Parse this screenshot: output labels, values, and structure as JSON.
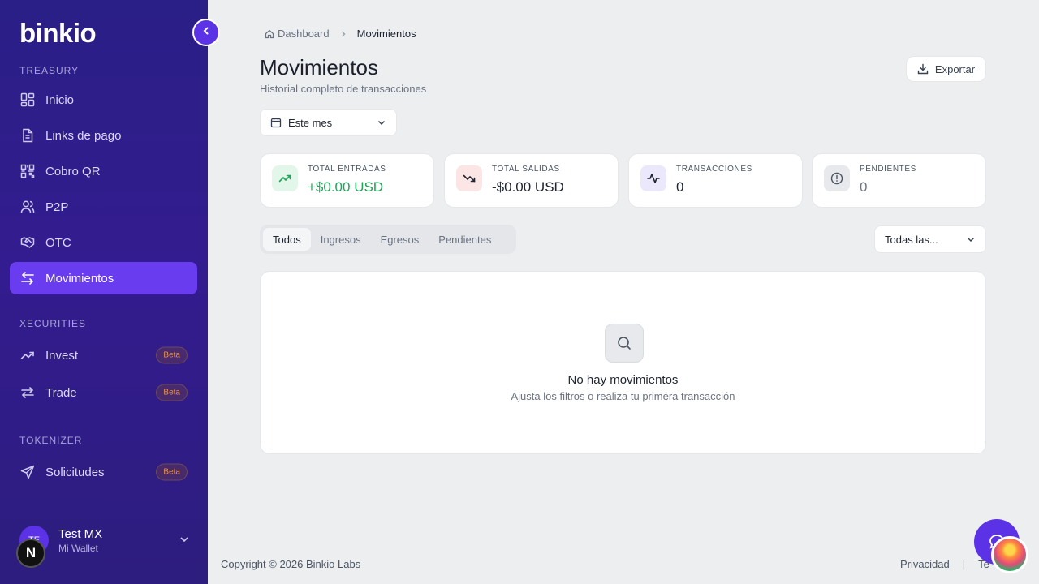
{
  "brand": {
    "logo_text": "binkio"
  },
  "sidebar": {
    "sections": [
      {
        "label": "TREASURY"
      },
      {
        "label": "XECURITIES"
      },
      {
        "label": "TOKENIZER"
      }
    ],
    "items": [
      {
        "label": "Inicio",
        "icon": "grid-icon"
      },
      {
        "label": "Links de pago",
        "icon": "document-icon"
      },
      {
        "label": "Cobro QR",
        "icon": "qr-icon"
      },
      {
        "label": "P2P",
        "icon": "users-icon"
      },
      {
        "label": "OTC",
        "icon": "handshake-icon"
      },
      {
        "label": "Movimientos",
        "icon": "arrows-icon",
        "active": true
      },
      {
        "label": "Invest",
        "icon": "trending-up-icon",
        "badge": "Beta"
      },
      {
        "label": "Trade",
        "icon": "swap-icon",
        "badge": "Beta"
      },
      {
        "label": "Solicitudes",
        "icon": "send-icon",
        "badge": "Beta"
      }
    ],
    "user": {
      "initials": "TE",
      "name": "Test MX",
      "wallet": "Mi Wallet"
    },
    "n_badge": "N"
  },
  "breadcrumb": {
    "home": "Dashboard",
    "current": "Movimientos"
  },
  "page": {
    "title": "Movimientos",
    "subtitle": "Historial completo de transacciones",
    "export_label": "Exportar",
    "period": "Este mes"
  },
  "stats": [
    {
      "label": "TOTAL ENTRADAS",
      "value": "+$0.00 USD",
      "color": "#22a35a",
      "bg": "#e3f6ea"
    },
    {
      "label": "TOTAL SALIDAS",
      "value": "-$0.00 USD",
      "color": "#1f2430",
      "bg": "#fbe5e5"
    },
    {
      "label": "TRANSACCIONES",
      "value": "0",
      "color": "#1f2430",
      "bg": "#ece8fb"
    },
    {
      "label": "PENDIENTES",
      "value": "0",
      "color": "#6b7280",
      "bg": "#e7e9ec"
    }
  ],
  "tabs": [
    {
      "label": "Todos",
      "active": true
    },
    {
      "label": "Ingresos"
    },
    {
      "label": "Egresos"
    },
    {
      "label": "Pendientes"
    }
  ],
  "filter": {
    "selected": "Todas las..."
  },
  "empty_state": {
    "title": "No hay movimientos",
    "subtitle": "Ajusta los filtros o realiza tu primera transacción"
  },
  "footer": {
    "copyright": "Copyright © 2026 Binkio Labs",
    "links": [
      "Privacidad",
      "|",
      "Te"
    ]
  },
  "colors": {
    "accent": "#6a3cf0",
    "sidebar_bg": "#2a1f86"
  }
}
